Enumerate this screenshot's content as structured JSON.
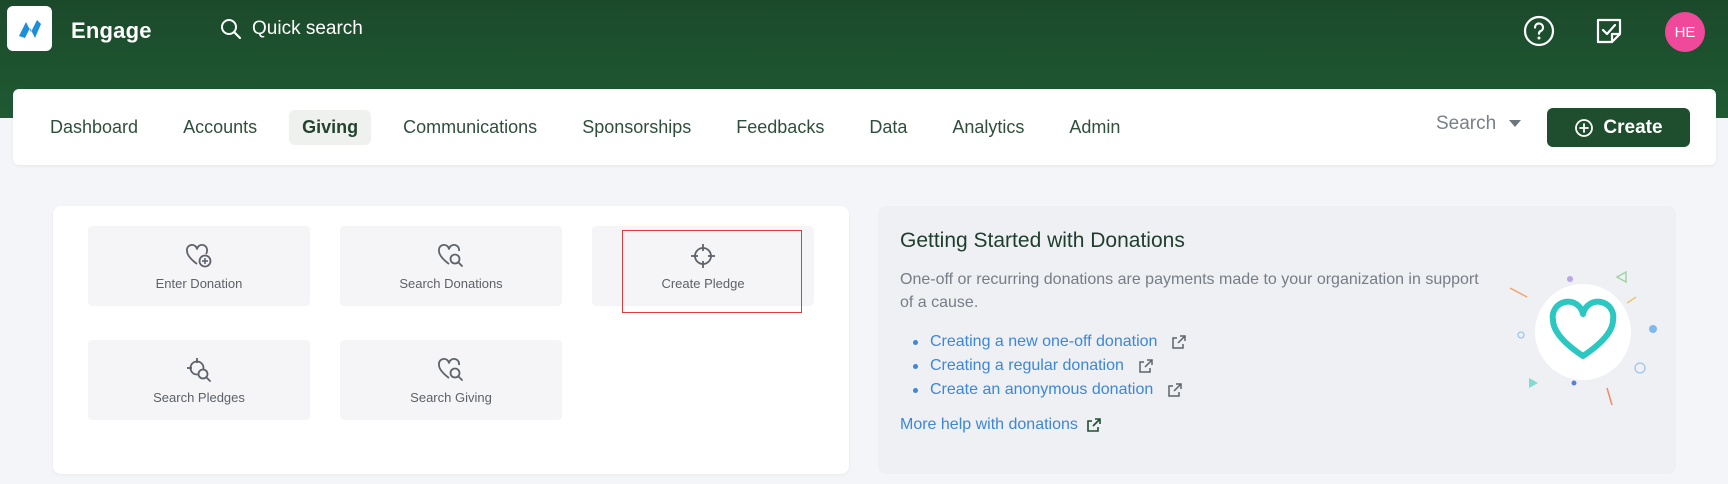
{
  "app": {
    "title": "Engage"
  },
  "quick_search": {
    "placeholder": "Quick search"
  },
  "user": {
    "initials": "HE"
  },
  "nav": {
    "items": [
      {
        "label": "Dashboard",
        "active": false
      },
      {
        "label": "Accounts",
        "active": false
      },
      {
        "label": "Giving",
        "active": true
      },
      {
        "label": "Communications",
        "active": false
      },
      {
        "label": "Sponsorships",
        "active": false
      },
      {
        "label": "Feedbacks",
        "active": false
      },
      {
        "label": "Data",
        "active": false
      },
      {
        "label": "Analytics",
        "active": false
      },
      {
        "label": "Admin",
        "active": false
      }
    ],
    "search_label": "Search",
    "create_label": "Create"
  },
  "tiles": [
    {
      "label": "Enter Donation",
      "icon": "heart-plus-icon"
    },
    {
      "label": "Search Donations",
      "icon": "heart-search-icon"
    },
    {
      "label": "Create Pledge",
      "icon": "crosshair-icon"
    },
    {
      "label": "Search Pledges",
      "icon": "crosshair-search-icon"
    },
    {
      "label": "Search Giving",
      "icon": "heart-search-icon"
    }
  ],
  "info": {
    "title": "Getting Started with Donations",
    "description": "One-off or recurring donations are payments made to your organization in support of a cause.",
    "links": [
      {
        "label": "Creating a new one-off donation"
      },
      {
        "label": "Creating a regular donation"
      },
      {
        "label": "Create an anonymous donation"
      }
    ],
    "more_help": "More help with donations"
  },
  "colors": {
    "header_green": "#1f5a33",
    "button_green": "#1f4e2e",
    "link_blue": "#3d86d8",
    "avatar_pink": "#f0489a",
    "heart_teal": "#2cc7c0",
    "highlight_red": "#e23b3b"
  }
}
